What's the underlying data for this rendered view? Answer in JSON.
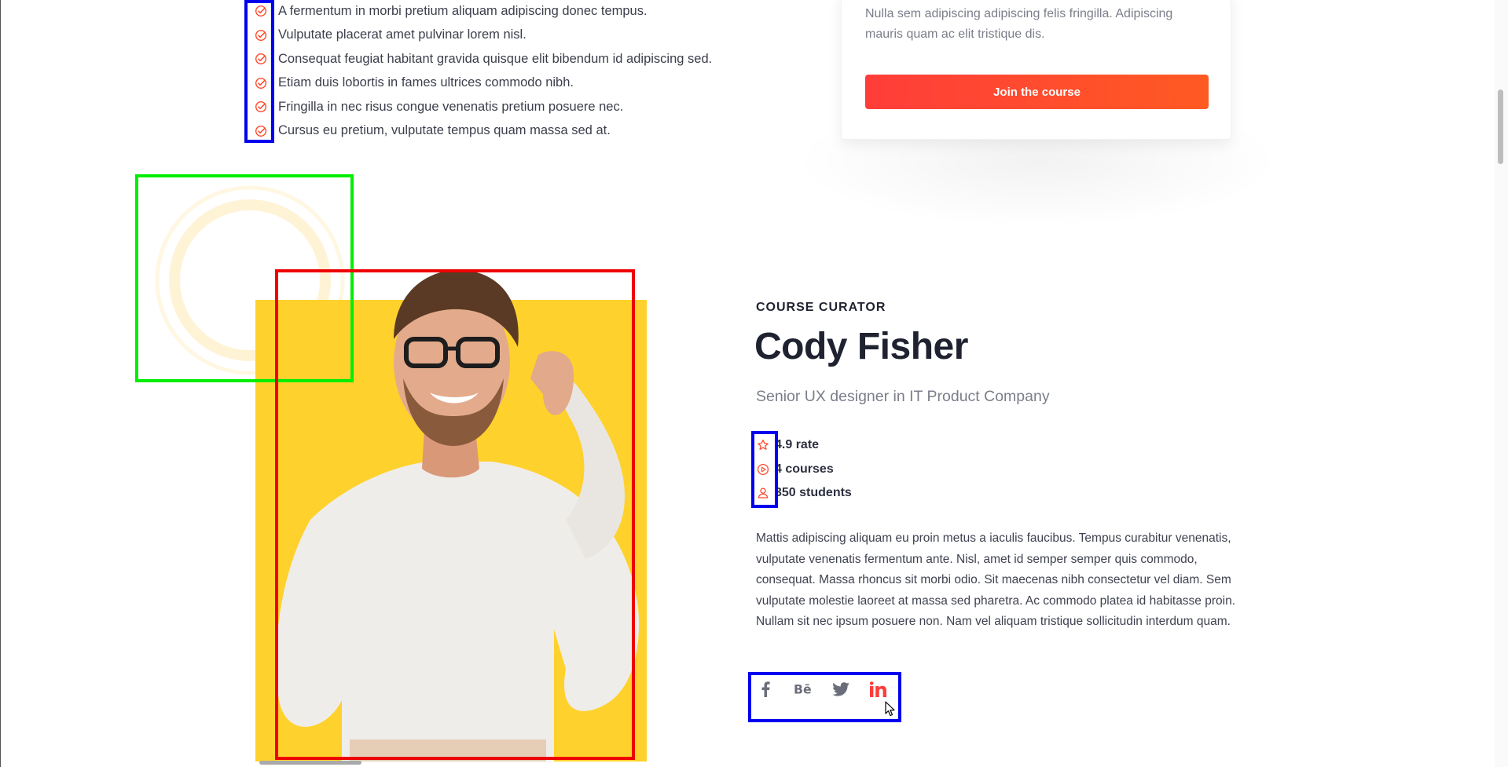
{
  "checklist": {
    "items": [
      "A fermentum in morbi pretium aliquam adipiscing donec tempus.",
      "Vulputate placerat amet pulvinar lorem nisl.",
      "Consequat feugiat habitant gravida quisque elit bibendum id adipiscing sed.",
      "Etiam duis lobortis in fames ultrices commodo nibh.",
      "Fringilla in nec risus congue venenatis pretium posuere nec.",
      "Cursus eu pretium, vulputate tempus quam massa sed at."
    ],
    "icon": "check-circle-icon"
  },
  "course_card": {
    "description": "Nulla sem adipiscing adipiscing felis fringilla. Adipiscing mauris quam ac elit tristique dis.",
    "button_label": "Join the course"
  },
  "curator": {
    "eyebrow": "COURSE CURATOR",
    "name": "Cody Fisher",
    "role": "Senior UX designer in IT Product Company",
    "stats": [
      {
        "icon": "star-icon",
        "label": "4.9 rate"
      },
      {
        "icon": "play-circle-icon",
        "label": "4 courses"
      },
      {
        "icon": "user-icon",
        "label": "350 students"
      }
    ],
    "bio": "Mattis adipiscing aliquam eu proin metus a iaculis faucibus. Tempus curabitur venenatis, vulputate venenatis fermentum ante. Nisl, amet id semper semper quis commodo, consequat. Massa rhoncus sit morbi odio. Sit maecenas nibh consectetur vel diam. Sem vulputate molestie laoreet at massa sed pharetra. Ac commodo platea id habitasse proin. Nullam sit nec ipsum posuere non. Nam vel aliquam tristique sollicitudin interdum quam.",
    "socials": [
      "facebook-icon",
      "behance-icon",
      "twitter-icon",
      "linkedin-icon"
    ]
  },
  "colors": {
    "accent": "#ff4a2c",
    "photo_bg": "#ffd12c",
    "heading": "#1f2230",
    "muted": "#7b7e8a",
    "social_gray": "#6b6e7a",
    "social_active": "#ff3d3a"
  }
}
